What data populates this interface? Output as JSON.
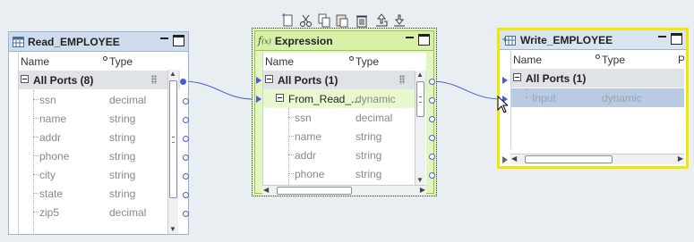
{
  "toolbar": {
    "icons": [
      "new-port-icon",
      "cut-icon",
      "copy-icon",
      "paste-icon",
      "delete-icon",
      "move-up-icon",
      "move-down-icon"
    ]
  },
  "read": {
    "title": "Read_EMPLOYEE",
    "col_name": "Name",
    "col_type": "Type",
    "group": "All Ports (8)",
    "ports": [
      {
        "name": "ssn",
        "type": "decimal"
      },
      {
        "name": "name",
        "type": "string"
      },
      {
        "name": "addr",
        "type": "string"
      },
      {
        "name": "phone",
        "type": "string"
      },
      {
        "name": "city",
        "type": "string"
      },
      {
        "name": "state",
        "type": "string"
      },
      {
        "name": "zip5",
        "type": "decimal"
      }
    ]
  },
  "expr": {
    "title": "Expression",
    "col_name": "Name",
    "col_type": "Type",
    "group": "All Ports (1)",
    "subgroup": {
      "name": "From_Read_...",
      "type": "dynamic"
    },
    "ports": [
      {
        "name": "ssn",
        "type": "decimal"
      },
      {
        "name": "name",
        "type": "string"
      },
      {
        "name": "addr",
        "type": "string"
      },
      {
        "name": "phone",
        "type": "string"
      }
    ]
  },
  "write": {
    "title": "Write_EMPLOYEE",
    "col_name": "Name",
    "col_type": "Type",
    "col_extra": "P",
    "group": "All Ports (1)",
    "ports": [
      {
        "name": "Input",
        "type": "dynamic"
      }
    ]
  },
  "colors": {
    "read_title": "#cfdced",
    "expr_title": "#d9f0a8",
    "expr_body": "#e4f6c0",
    "write_title": "#d8e4f0",
    "write_border": "#f3e600",
    "link": "#4a5bd0",
    "selected_row": "#b9cbe2"
  }
}
